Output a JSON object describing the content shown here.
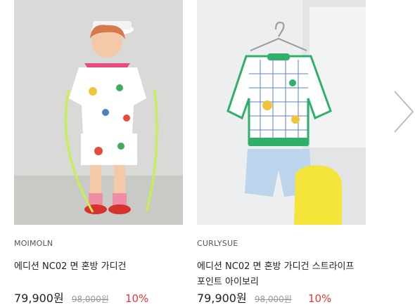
{
  "products": [
    {
      "brand": "MOIMOLN",
      "name_line1": "에디션 NC02 면 혼방 가디건",
      "name_line2": "",
      "price": "79,900원",
      "original_price": "98,000원",
      "discount": "10%"
    },
    {
      "brand": "CURLYSUE",
      "name_line1": "에디션 NC02 면 혼방 가디건 스트라이프",
      "name_line2": "포인트 아이보리",
      "price": "79,900원",
      "original_price": "98,000원",
      "discount": "10%"
    }
  ],
  "icons": {
    "next": "chevron-right-icon"
  },
  "colors": {
    "discount": "#e8373e",
    "price": "#222222",
    "original_price": "#999999"
  }
}
